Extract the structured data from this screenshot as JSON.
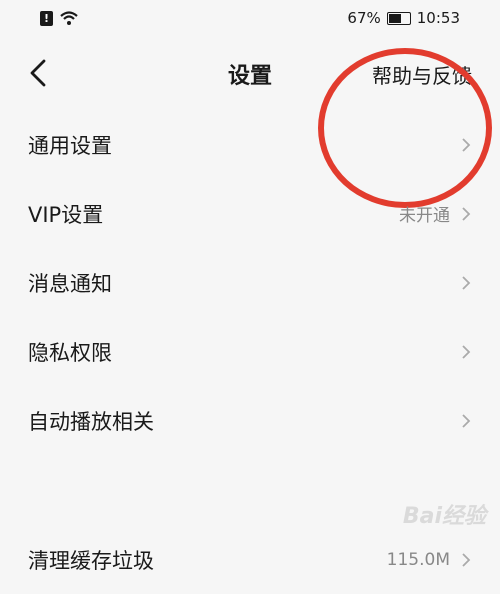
{
  "status_bar": {
    "battery_text": "67%",
    "time": "10:53",
    "battery_level": 0.67
  },
  "header": {
    "title": "设置",
    "help_label": "帮助与反馈"
  },
  "menu": {
    "items": [
      {
        "label": "通用设置",
        "value": ""
      },
      {
        "label": "VIP设置",
        "value": "未开通"
      },
      {
        "label": "消息通知",
        "value": ""
      },
      {
        "label": "隐私权限",
        "value": ""
      },
      {
        "label": "自动播放相关",
        "value": ""
      },
      {
        "label": "清理缓存垃圾",
        "value": "115.0M"
      }
    ]
  },
  "watermark": {
    "text": "Bai经验"
  },
  "colors": {
    "annotation_circle": "#e23c2e",
    "background": "#f6f6f6"
  }
}
